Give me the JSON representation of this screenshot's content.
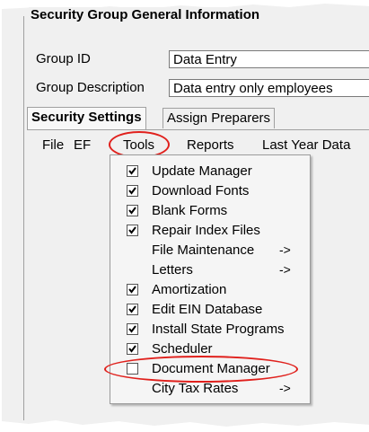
{
  "group_box": {
    "title": "Security Group General Information"
  },
  "fields": {
    "group_id": {
      "label": "Group ID",
      "value": "Data Entry"
    },
    "group_description": {
      "label": "Group Description",
      "value": "Data entry only employees"
    }
  },
  "tabs": [
    {
      "label": "Security Settings"
    },
    {
      "label": "Assign Preparers"
    }
  ],
  "menubar": [
    {
      "label": "File"
    },
    {
      "label": "EF"
    },
    {
      "label": "Tools"
    },
    {
      "label": "Reports"
    },
    {
      "label": "Last Year Data"
    }
  ],
  "tools_menu": {
    "items": [
      {
        "label": "Update Manager",
        "checked": true,
        "submenu_arrow": ""
      },
      {
        "label": "Download Fonts",
        "checked": true,
        "submenu_arrow": ""
      },
      {
        "label": "Blank Forms",
        "checked": true,
        "submenu_arrow": ""
      },
      {
        "label": "Repair Index Files",
        "checked": true,
        "submenu_arrow": ""
      },
      {
        "label": "File Maintenance",
        "checked": null,
        "submenu_arrow": "->"
      },
      {
        "label": "Letters",
        "checked": null,
        "submenu_arrow": "->"
      },
      {
        "label": "Amortization",
        "checked": true,
        "submenu_arrow": ""
      },
      {
        "label": "Edit EIN Database",
        "checked": true,
        "submenu_arrow": ""
      },
      {
        "label": "Install State Programs",
        "checked": true,
        "submenu_arrow": ""
      },
      {
        "label": "Scheduler",
        "checked": true,
        "submenu_arrow": ""
      },
      {
        "label": "Document Manager",
        "checked": false,
        "submenu_arrow": ""
      },
      {
        "label": "City Tax Rates",
        "checked": null,
        "submenu_arrow": "->"
      }
    ]
  },
  "colors": {
    "highlight": "#e0201c",
    "background": "#f0f0f0"
  }
}
